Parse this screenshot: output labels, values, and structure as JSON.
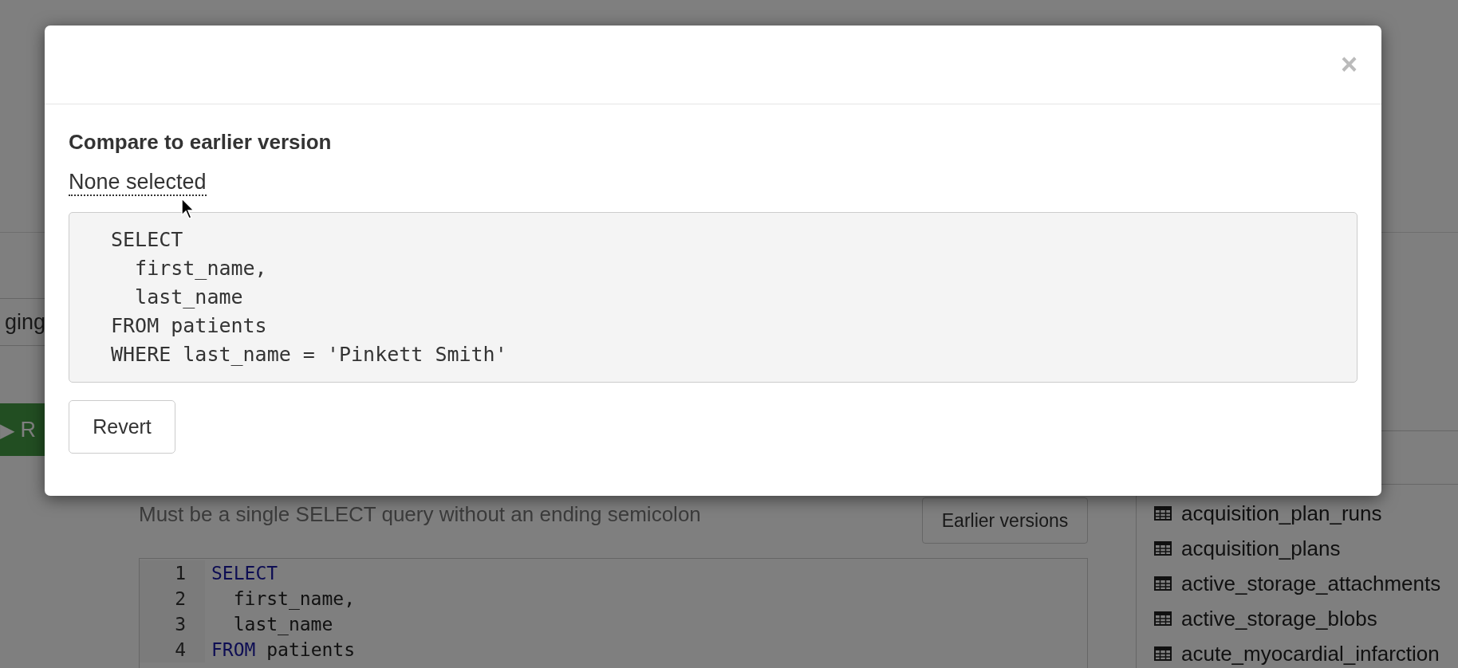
{
  "background": {
    "query_field": "ging",
    "run_button": {
      "icon": "▶",
      "label": "R"
    },
    "hint": "Must be a single SELECT query without an ending semicolon",
    "earlier_versions_button": "Earlier versions",
    "editor": [
      {
        "number": "1",
        "tokens": [
          {
            "text": "SELECT",
            "kind": "keyword"
          }
        ]
      },
      {
        "number": "2",
        "tokens": [
          {
            "text": "  first_name,",
            "kind": "plain"
          }
        ]
      },
      {
        "number": "3",
        "tokens": [
          {
            "text": "  last_name",
            "kind": "plain"
          }
        ]
      },
      {
        "number": "4",
        "tokens": [
          {
            "text": "FROM",
            "kind": "keyword"
          },
          {
            "text": " patients",
            "kind": "plain"
          }
        ]
      }
    ],
    "tables": [
      "acquisition_plan_runs",
      "acquisition_plans",
      "active_storage_attachments",
      "active_storage_blobs",
      "acute_myocardial_infarction"
    ]
  },
  "modal": {
    "close": "×",
    "title": "Compare to earlier version",
    "version_select": "None selected",
    "code_lines": [
      "SELECT",
      "  first_name,",
      "  last_name",
      "FROM patients",
      "WHERE last_name = 'Pinkett Smith'"
    ],
    "revert_button": "Revert"
  }
}
